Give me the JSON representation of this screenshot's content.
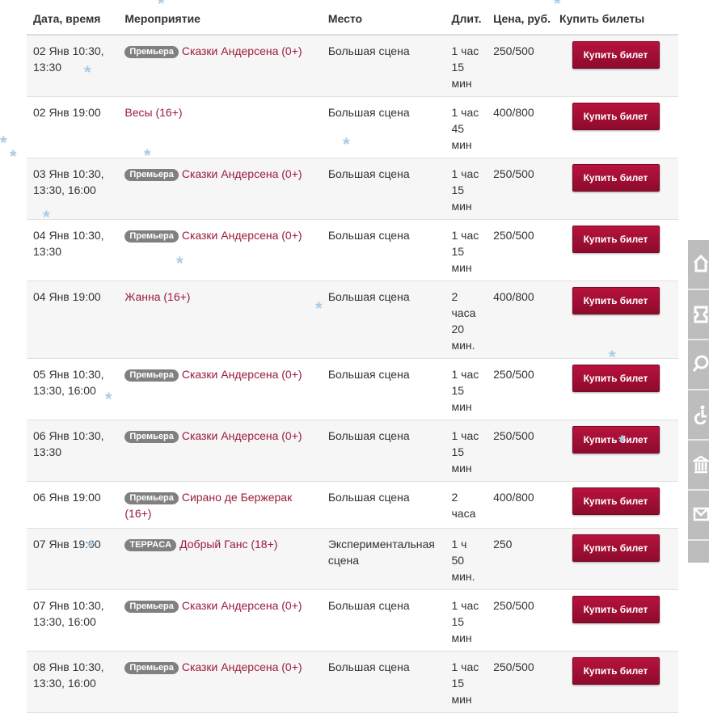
{
  "table": {
    "headers": {
      "date": "Дата, время",
      "event": "Мероприятие",
      "place": "Место",
      "duration": "Длит.",
      "price": "Цена, руб.",
      "buy": "Купить билеты"
    },
    "rows": [
      {
        "date": "02 Янв 10:30, 13:30",
        "badge": "Премьера",
        "event": "Сказки Андерсена (0+)",
        "place": "Большая сцена",
        "duration": "1 час 15 мин",
        "price": "250/500",
        "button": "Купить билет"
      },
      {
        "date": "02 Янв 19:00",
        "badge": "",
        "event": "Весы (16+)",
        "place": "Большая сцена",
        "duration": "1 час 45 мин",
        "price": "400/800",
        "button": "Купить билет"
      },
      {
        "date": "03 Янв 10:30, 13:30, 16:00",
        "badge": "Премьера",
        "event": "Сказки Андерсена (0+)",
        "place": "Большая сцена",
        "duration": "1 час 15 мин",
        "price": "250/500",
        "button": "Купить билет"
      },
      {
        "date": "04 Янв 10:30, 13:30",
        "badge": "Премьера",
        "event": "Сказки Андерсена (0+)",
        "place": "Большая сцена",
        "duration": "1 час 15 мин",
        "price": "250/500",
        "button": "Купить билет"
      },
      {
        "date": "04 Янв 19:00",
        "badge": "",
        "event": "Жанна (16+)",
        "place": "Большая сцена",
        "duration": "2 часа 20 мин.",
        "price": "400/800",
        "button": "Купить билет"
      },
      {
        "date": "05 Янв 10:30, 13:30, 16:00",
        "badge": "Премьера",
        "event": "Сказки Андерсена (0+)",
        "place": "Большая сцена",
        "duration": "1 час 15 мин",
        "price": "250/500",
        "button": "Купить билет"
      },
      {
        "date": "06 Янв 10:30, 13:30",
        "badge": "Премьера",
        "event": "Сказки Андерсена (0+)",
        "place": "Большая сцена",
        "duration": "1 час 15 мин",
        "price": "250/500",
        "button": "Купить билет"
      },
      {
        "date": "06 Янв 19:00",
        "badge": "Премьера",
        "event": "Сирано де Бержерак (16+)",
        "place": "Большая сцена",
        "duration": "2 часа",
        "price": "400/800",
        "button": "Купить билет"
      },
      {
        "date": "07 Янв 19:00",
        "badge": "TEPPACA",
        "event": "Добрый Ганс (18+)",
        "place": "Экспериментальная сцена",
        "duration": "1 ч 50 мин.",
        "price": "250",
        "button": "Купить билет"
      },
      {
        "date": "07 Янв 10:30, 13:30, 16:00",
        "badge": "Премьера",
        "event": "Сказки Андерсена (0+)",
        "place": "Большая сцена",
        "duration": "1 час 15 мин",
        "price": "250/500",
        "button": "Купить билет"
      },
      {
        "date": "08 Янв 10:30, 13:30, 16:00",
        "badge": "Премьера",
        "event": "Сказки Андерсена (0+)",
        "place": "Большая сцена",
        "duration": "1 час 15 мин",
        "price": "250/500",
        "button": "Купить билет"
      }
    ]
  },
  "side_bar": {
    "icons": [
      "home-icon",
      "ticket-icon",
      "search-icon",
      "accessibility-icon",
      "theatre-icon",
      "mail-icon"
    ]
  },
  "colors": {
    "accent": "#9b1b3b",
    "button": "#a50f35",
    "badge": "#808080"
  }
}
